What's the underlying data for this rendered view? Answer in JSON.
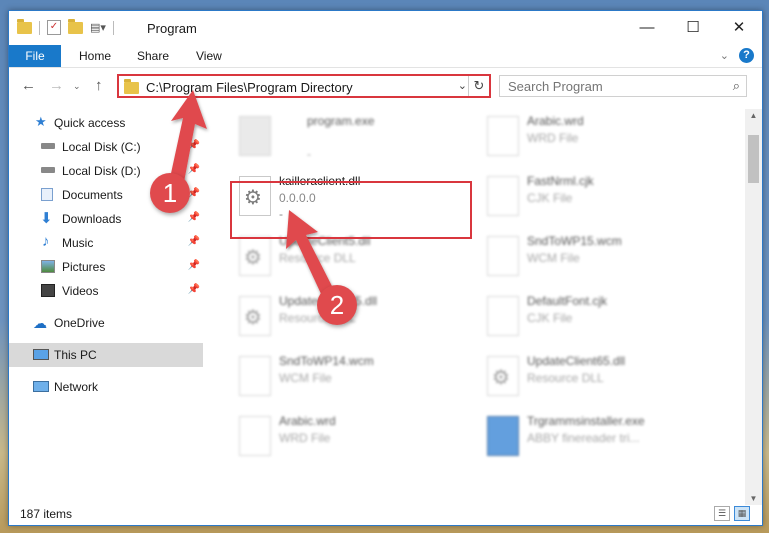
{
  "window": {
    "title": "Program",
    "minimize": "—",
    "maximize": "☐",
    "close": "✕"
  },
  "ribbon": {
    "tabs": [
      "File",
      "Home",
      "Share",
      "View"
    ],
    "help": "?"
  },
  "nav": {
    "back": "←",
    "forward": "→",
    "up": "↑",
    "address": "C:\\Program Files\\Program Directory",
    "search_placeholder": "Search Program"
  },
  "sidebar": {
    "items": [
      {
        "label": "Quick access",
        "icon": "star-icon"
      },
      {
        "label": "Local Disk (C:)",
        "icon": "drive-icon",
        "pinned": true
      },
      {
        "label": "Local Disk (D:)",
        "icon": "drive-icon",
        "pinned": true
      },
      {
        "label": "Documents",
        "icon": "documents-icon",
        "pinned": true
      },
      {
        "label": "Downloads",
        "icon": "download-icon",
        "pinned": true
      },
      {
        "label": "Music",
        "icon": "music-icon",
        "pinned": true
      },
      {
        "label": "Pictures",
        "icon": "pictures-icon",
        "pinned": true
      },
      {
        "label": "Videos",
        "icon": "videos-icon",
        "pinned": true
      },
      {
        "label": "OneDrive",
        "icon": "cloud-icon"
      },
      {
        "label": "This PC",
        "icon": "computer-icon",
        "selected": true
      },
      {
        "label": "Network",
        "icon": "network-icon"
      }
    ]
  },
  "files": [
    {
      "name": "program.exe",
      "sub": "",
      "sub2": "-",
      "blurred": true
    },
    {
      "name": "Arabic.wrd",
      "sub": "WRD File",
      "blurred": true
    },
    {
      "name": "kailleraclient.dll",
      "sub": "0.0.0.0",
      "sub2": "-",
      "blurred": false
    },
    {
      "name": "FastNrml.cjk",
      "sub": "CJK File",
      "blurred": true
    },
    {
      "name": "UpdateClient5.dll",
      "sub": "Resource DLL",
      "blurred": true
    },
    {
      "name": "SndToWP15.wcm",
      "sub": "WCM File",
      "blurred": true
    },
    {
      "name": "UpdateClient65.dll",
      "sub": "Resource DLL",
      "blurred": true
    },
    {
      "name": "DefaultFont.cjk",
      "sub": "CJK File",
      "blurred": true
    },
    {
      "name": "SndToWP14.wcm",
      "sub": "WCM File",
      "blurred": true
    },
    {
      "name": "UpdateClient65.dll",
      "sub": "Resource DLL",
      "blurred": true
    },
    {
      "name": "Arabic.wrd",
      "sub": "WRD File",
      "blurred": true
    },
    {
      "name": "Trgrammsinstaller.exe",
      "sub": "ABBY finereader tri...",
      "blurred": true
    }
  ],
  "status": {
    "items": "187 items"
  },
  "callouts": {
    "step1": "1",
    "step2": "2"
  },
  "colors": {
    "accent": "#1979ca",
    "callout": "#e04a4d"
  }
}
